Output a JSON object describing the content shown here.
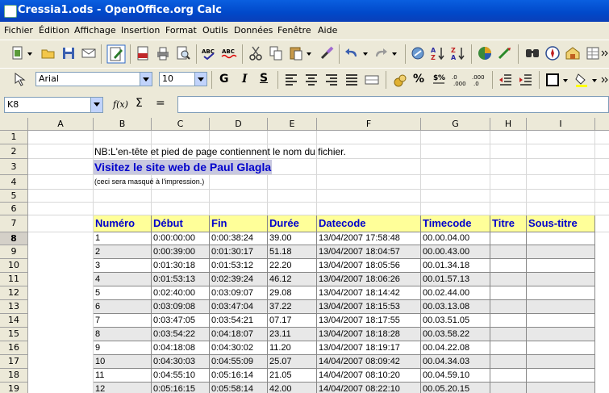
{
  "window": {
    "title": "Cressia1.ods - OpenOffice.org Calc"
  },
  "menu": [
    "Fichier",
    "Édition",
    "Affichage",
    "Insertion",
    "Format",
    "Outils",
    "Données",
    "Fenêtre",
    "Aide"
  ],
  "format_bar": {
    "font_name": "Arial",
    "font_size": "10",
    "bold_label": "G",
    "italic_label": "I",
    "underline_label": "S"
  },
  "formula_bar": {
    "cell_ref": "K8",
    "function_label": "f(x)",
    "sum_label": "Σ",
    "equals_label": "=",
    "formula_value": ""
  },
  "sheet": {
    "columns": [
      "A",
      "B",
      "C",
      "D",
      "E",
      "F",
      "G",
      "H",
      "I"
    ],
    "rows": [
      "1",
      "2",
      "3",
      "4",
      "5",
      "6",
      "7",
      "8",
      "9",
      "10",
      "11",
      "12",
      "13",
      "14",
      "15",
      "16",
      "17",
      "18",
      "19"
    ],
    "active_row": "8",
    "note": "NB:L'en-tête et pied de page contiennent le nom du fichier.",
    "link": "Visitez le site web de Paul Glagla",
    "hint": "(ceci sera masqué à l'impression.)",
    "headers": [
      "Numéro",
      "Début",
      "Fin",
      "Durée",
      "Datecode",
      "Timecode",
      "Titre",
      "Sous-titre"
    ],
    "data": [
      [
        "1",
        "0:00:00:00",
        "0:00:38:24",
        "39.00",
        "13/04/2007 17:58:48",
        "00.00.04.00"
      ],
      [
        "2",
        "0:00:39:00",
        "0:01:30:17",
        "51.18",
        "13/04/2007 18:04:57",
        "00.00.43.00"
      ],
      [
        "3",
        "0:01:30:18",
        "0:01:53:12",
        "22.20",
        "13/04/2007 18:05:56",
        "00.01.34.18"
      ],
      [
        "4",
        "0:01:53:13",
        "0:02:39:24",
        "46.12",
        "13/04/2007 18:06:26",
        "00.01.57.13"
      ],
      [
        "5",
        "0:02:40:00",
        "0:03:09:07",
        "29.08",
        "13/04/2007 18:14:42",
        "00.02.44.00"
      ],
      [
        "6",
        "0:03:09:08",
        "0:03:47:04",
        "37.22",
        "13/04/2007 18:15:53",
        "00.03.13.08"
      ],
      [
        "7",
        "0:03:47:05",
        "0:03:54:21",
        "07.17",
        "13/04/2007 18:17:55",
        "00.03.51.05"
      ],
      [
        "8",
        "0:03:54:22",
        "0:04:18:07",
        "23.11",
        "13/04/2007 18:18:28",
        "00.03.58.22"
      ],
      [
        "9",
        "0:04:18:08",
        "0:04:30:02",
        "11.20",
        "13/04/2007 18:19:17",
        "00.04.22.08"
      ],
      [
        "10",
        "0:04:30:03",
        "0:04:55:09",
        "25.07",
        "14/04/2007 08:09:42",
        "00.04.34.03"
      ],
      [
        "11",
        "0:04:55:10",
        "0:05:16:14",
        "21.05",
        "14/04/2007 08:10:20",
        "00.04.59.10"
      ],
      [
        "12",
        "0:05:16:15",
        "0:05:58:14",
        "42.00",
        "14/04/2007 08:22:10",
        "00.05.20.15"
      ]
    ]
  }
}
